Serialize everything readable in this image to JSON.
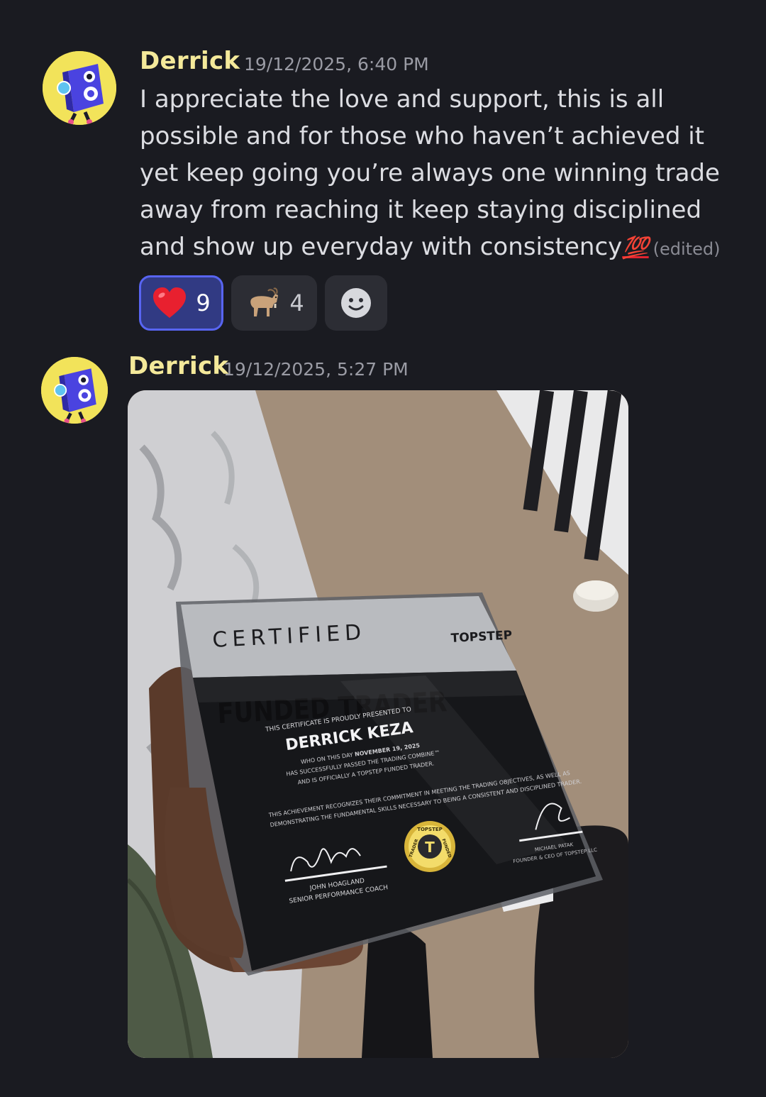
{
  "messages": [
    {
      "username": "Derrick",
      "timestamp": "19/12/2025, 6:40 PM",
      "text": "I appreciate the love and support, this is all possible and for those who haven’t achieved it yet keep going you’re always one winning trade away from reaching it keep staying disciplined and show up everyday with consistency",
      "emoji": "💯",
      "edited_label": "(edited)",
      "reactions": [
        {
          "emoji": "❤️",
          "icon": "heart-icon",
          "count": "9",
          "active": true
        },
        {
          "emoji": "🐐",
          "icon": "goat-icon",
          "count": "4",
          "active": false
        },
        {
          "icon": "add-reaction-smiley-icon"
        }
      ]
    },
    {
      "username": "Derrick",
      "timestamp": "19/12/2025, 5:27 PM",
      "attachment": {
        "certificate": {
          "heading_top": "CERTIFIED",
          "heading_main": "FUNDED TRADER",
          "brand": "TOPSTEP",
          "presented_line": "THIS CERTIFICATE IS PROUDLY PRESENTED TO",
          "recipient": "DERRICK KEZA",
          "body_line1_prefix": "WHO ON THIS DAY",
          "body_line1_date": "NOVEMBER 19, 2025",
          "body_line2": "HAS SUCCESSFULLY PASSED THE TRADING COMBINE™",
          "body_line3": "AND IS OFFICIALLY A TOPSTEP FUNDED TRADER.",
          "recognition_line1": "THIS ACHIEVEMENT RECOGNIZES THEIR COMMITMENT IN MEETING THE TRADING OBJECTIVES, AS WELL AS",
          "recognition_line2": "DEMONSTRATING THE FUNDAMENTAL SKILLS NECESSARY TO BEING A CONSISTENT AND DISCIPLINED TRADER.",
          "signer1_name": "JOHN HOAGLAND",
          "signer1_title": "SENIOR PERFORMANCE COACH",
          "signer2_name": "MICHAEL PATAK",
          "signer2_title": "FOUNDER & CEO OF TOPSTEP LLC",
          "seal_top": "TOPSTEP",
          "seal_left": "TRADER",
          "seal_right": "FUNDED",
          "seal_letter": "T"
        }
      }
    }
  ],
  "colors": {
    "background": "#1a1b21",
    "username": "#f4e99a",
    "timestamp": "#9a9ba4",
    "message_text": "#dcdde2",
    "reaction_active_bg": "#313a83",
    "reaction_active_border": "#5865f2",
    "reaction_bg": "#2c2d34"
  }
}
